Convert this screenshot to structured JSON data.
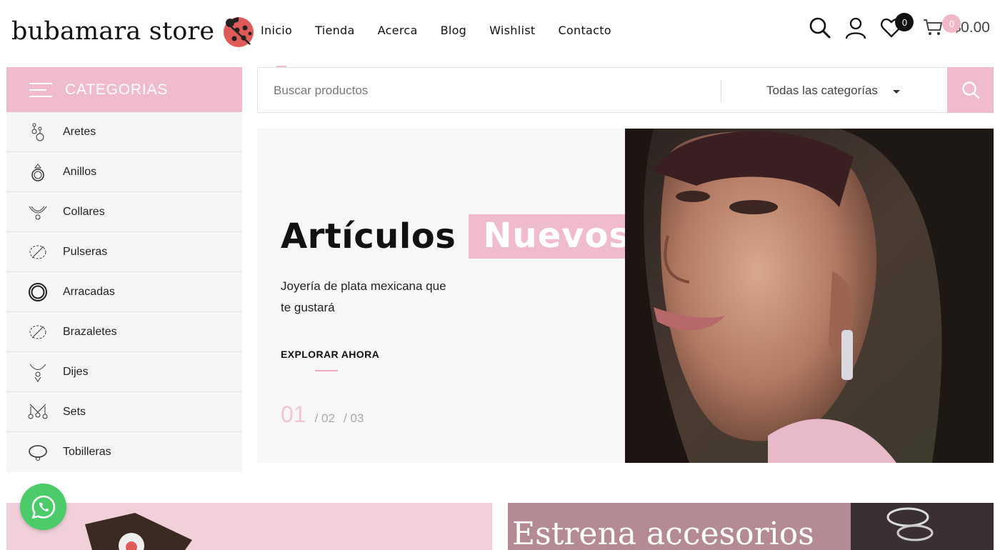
{
  "brand": {
    "name": "bubamara store",
    "accent": "#f0bccd",
    "logo_icon": "ladybug-icon"
  },
  "nav": {
    "items": [
      "Inicio",
      "Tienda",
      "Acerca",
      "Blog",
      "Wishlist",
      "Contacto"
    ]
  },
  "header": {
    "wishlist_count": "0",
    "cart_count": "0",
    "cart_total": "$0.00"
  },
  "categories": {
    "title": "CATEGORIAS",
    "items": [
      {
        "label": "Aretes",
        "icon": "earring-icon"
      },
      {
        "label": "Anillos",
        "icon": "ring-icon"
      },
      {
        "label": "Collares",
        "icon": "necklace-icon"
      },
      {
        "label": "Pulseras",
        "icon": "bracelet-icon"
      },
      {
        "label": "Arracadas",
        "icon": "hoop-icon"
      },
      {
        "label": "Brazaletes",
        "icon": "bangle-icon"
      },
      {
        "label": "Dijes",
        "icon": "pendant-icon"
      },
      {
        "label": "Sets",
        "icon": "set-icon"
      },
      {
        "label": "Tobilleras",
        "icon": "anklet-icon"
      }
    ]
  },
  "search": {
    "placeholder": "Buscar productos",
    "category": "Todas las categorías"
  },
  "hero": {
    "title_main": "Artículos",
    "title_highlight": "Nuevos",
    "subtitle": "Joyería de plata mexicana que te gustará",
    "cta": "EXPLORAR AHORA",
    "slide_current": "01",
    "slide_2": "/ 02",
    "slide_3": "/ 03"
  },
  "banners": {
    "right_text": "Estrena accesorios"
  }
}
